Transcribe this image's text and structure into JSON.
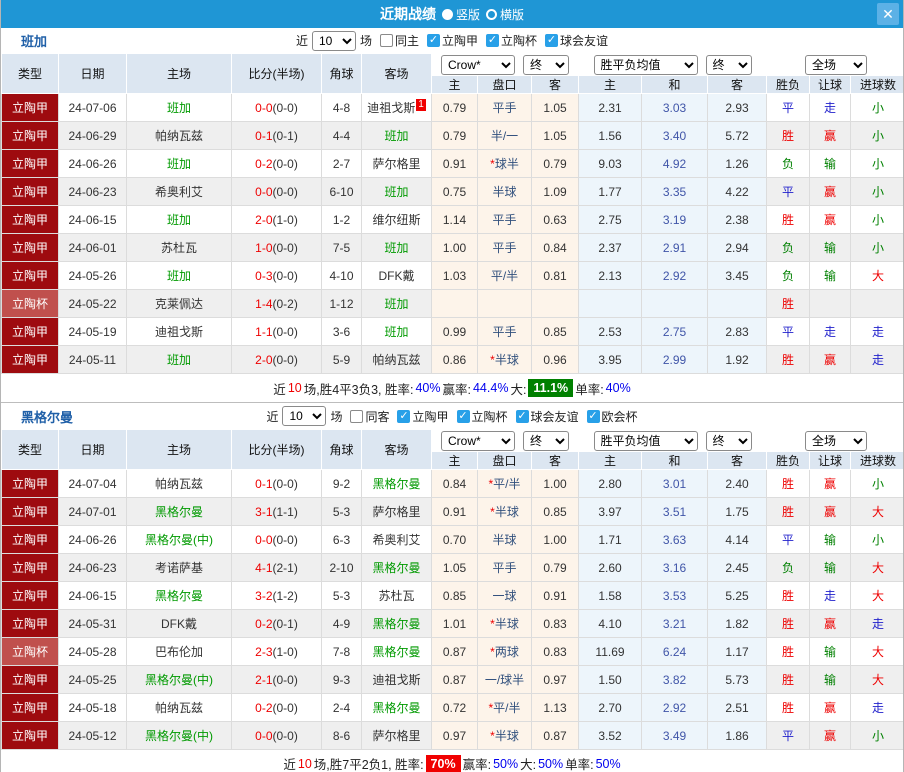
{
  "title_bar": {
    "title": "近期战绩",
    "layout_options": [
      {
        "label": "竖版",
        "selected": true
      },
      {
        "label": "横版",
        "selected": false
      }
    ],
    "close_icon": "✕"
  },
  "table_header": {
    "cols": [
      "类型",
      "日期",
      "主场",
      "比分(半场)",
      "角球",
      "客场"
    ],
    "sub_cols": [
      "主",
      "盘口",
      "客",
      "主",
      "和",
      "客",
      "胜负",
      "让球",
      "进球数"
    ],
    "selects": {
      "bookmaker": "Crow*",
      "final1": "终",
      "avg": "胜平负均值",
      "final2": "终",
      "scope": "全场"
    }
  },
  "result_colors": {
    "胜": "#ee0000",
    "赢": "#ee0000",
    "大": "#ee0000",
    "平": "#2222cc",
    "走": "#2222cc",
    "负": "#008000",
    "输": "#008000",
    "小": "#008000"
  },
  "colors": {
    "title_bar": "#1f96d5",
    "league_cell": "#9e0b0f",
    "cup_cell": "#c0504d",
    "handicap_bg": "#fdf4ea",
    "odds_bg": "#edf5fb",
    "header_bg": "#dce6f1"
  },
  "sections": [
    {
      "team": "班加",
      "filter": {
        "prefix": "近",
        "count": "10",
        "suffix": "场",
        "checkboxes": [
          {
            "label": "同主",
            "checked": false
          },
          {
            "label": "立陶甲",
            "checked": true
          },
          {
            "label": "立陶杯",
            "checked": true
          },
          {
            "label": "球会友谊",
            "checked": true
          }
        ]
      },
      "rows": [
        {
          "league": "立陶甲",
          "cup": false,
          "date": "24-07-06",
          "home": "班加",
          "home_active": true,
          "score": "0-0",
          "half": "(0-0)",
          "corners": "4-8",
          "away": "迪祖戈斯",
          "away_active": false,
          "away_badge": "1",
          "ah": [
            "0.79",
            "平手",
            "1.05"
          ],
          "odds": [
            "2.31",
            "3.03",
            "2.93"
          ],
          "results": [
            "平",
            "走",
            "小"
          ]
        },
        {
          "league": "立陶甲",
          "cup": false,
          "date": "24-06-29",
          "home": "帕纳瓦兹",
          "home_active": false,
          "score": "0-1",
          "half": "(0-1)",
          "corners": "4-4",
          "away": "班加",
          "away_active": true,
          "away_badge": "",
          "ah": [
            "0.79",
            "半/一",
            "1.05"
          ],
          "odds": [
            "1.56",
            "3.40",
            "5.72"
          ],
          "results": [
            "胜",
            "赢",
            "小"
          ]
        },
        {
          "league": "立陶甲",
          "cup": false,
          "date": "24-06-26",
          "home": "班加",
          "home_active": true,
          "score": "0-2",
          "half": "(0-0)",
          "corners": "2-7",
          "away": "萨尔格里",
          "away_active": false,
          "away_badge": "",
          "ah": [
            "0.91",
            "*球半",
            "0.79"
          ],
          "odds": [
            "9.03",
            "4.92",
            "1.26"
          ],
          "results": [
            "负",
            "输",
            "小"
          ]
        },
        {
          "league": "立陶甲",
          "cup": false,
          "date": "24-06-23",
          "home": "希奥利艾",
          "home_active": false,
          "score": "0-0",
          "half": "(0-0)",
          "corners": "6-10",
          "away": "班加",
          "away_active": true,
          "away_badge": "",
          "ah": [
            "0.75",
            "半球",
            "1.09"
          ],
          "odds": [
            "1.77",
            "3.35",
            "4.22"
          ],
          "results": [
            "平",
            "赢",
            "小"
          ]
        },
        {
          "league": "立陶甲",
          "cup": false,
          "date": "24-06-15",
          "home": "班加",
          "home_active": true,
          "score": "2-0",
          "half": "(1-0)",
          "corners": "1-2",
          "away": "维尔纽斯",
          "away_active": false,
          "away_badge": "",
          "ah": [
            "1.14",
            "平手",
            "0.63"
          ],
          "odds": [
            "2.75",
            "3.19",
            "2.38"
          ],
          "results": [
            "胜",
            "赢",
            "小"
          ]
        },
        {
          "league": "立陶甲",
          "cup": false,
          "date": "24-06-01",
          "home": "苏杜瓦",
          "home_active": false,
          "score": "1-0",
          "half": "(0-0)",
          "corners": "7-5",
          "away": "班加",
          "away_active": true,
          "away_badge": "",
          "ah": [
            "1.00",
            "平手",
            "0.84"
          ],
          "odds": [
            "2.37",
            "2.91",
            "2.94"
          ],
          "results": [
            "负",
            "输",
            "小"
          ]
        },
        {
          "league": "立陶甲",
          "cup": false,
          "date": "24-05-26",
          "home": "班加",
          "home_active": true,
          "score": "0-3",
          "half": "(0-0)",
          "corners": "4-10",
          "away": "DFK戴",
          "away_active": false,
          "away_badge": "",
          "ah": [
            "1.03",
            "平/半",
            "0.81"
          ],
          "odds": [
            "2.13",
            "2.92",
            "3.45"
          ],
          "results": [
            "负",
            "输",
            "大"
          ]
        },
        {
          "league": "立陶杯",
          "cup": true,
          "date": "24-05-22",
          "home": "克莱佩达",
          "home_active": false,
          "score": "1-4",
          "half": "(0-2)",
          "corners": "1-12",
          "away": "班加",
          "away_active": true,
          "away_badge": "",
          "ah": [
            "",
            "",
            ""
          ],
          "odds": [
            "",
            "",
            ""
          ],
          "results": [
            "胜",
            "",
            ""
          ]
        },
        {
          "league": "立陶甲",
          "cup": false,
          "date": "24-05-19",
          "home": "迪祖戈斯",
          "home_active": false,
          "score": "1-1",
          "half": "(0-0)",
          "corners": "3-6",
          "away": "班加",
          "away_active": true,
          "away_badge": "",
          "ah": [
            "0.99",
            "平手",
            "0.85"
          ],
          "odds": [
            "2.53",
            "2.75",
            "2.83"
          ],
          "results": [
            "平",
            "走",
            "走"
          ]
        },
        {
          "league": "立陶甲",
          "cup": false,
          "date": "24-05-11",
          "home": "班加",
          "home_active": true,
          "score": "2-0",
          "half": "(0-0)",
          "corners": "5-9",
          "away": "帕纳瓦兹",
          "away_active": false,
          "away_badge": "",
          "ah": [
            "0.86",
            "*半球",
            "0.96"
          ],
          "odds": [
            "3.95",
            "2.99",
            "1.92"
          ],
          "results": [
            "胜",
            "赢",
            "走"
          ]
        }
      ],
      "summary": [
        {
          "text": "近",
          "style": "plain"
        },
        {
          "text": "10",
          "style": "red"
        },
        {
          "text": "场,胜4平3负3, 胜率:",
          "style": "plain"
        },
        {
          "text": "40%",
          "style": "blue"
        },
        {
          "text": " 赢率:",
          "style": "plain"
        },
        {
          "text": "44.4%",
          "style": "blue"
        },
        {
          "text": " 大:",
          "style": "plain"
        },
        {
          "text": "11.1%",
          "style": "green-badge"
        },
        {
          "text": " 单率:",
          "style": "plain"
        },
        {
          "text": "40%",
          "style": "blue"
        }
      ]
    },
    {
      "team": "黑格尔曼",
      "filter": {
        "prefix": "近",
        "count": "10",
        "suffix": "场",
        "checkboxes": [
          {
            "label": "同客",
            "checked": false
          },
          {
            "label": "立陶甲",
            "checked": true
          },
          {
            "label": "立陶杯",
            "checked": true
          },
          {
            "label": "球会友谊",
            "checked": true
          },
          {
            "label": "欧会杯",
            "checked": true
          }
        ]
      },
      "rows": [
        {
          "league": "立陶甲",
          "cup": false,
          "date": "24-07-04",
          "home": "帕纳瓦兹",
          "home_active": false,
          "score": "0-1",
          "half": "(0-0)",
          "corners": "9-2",
          "away": "黑格尔曼",
          "away_active": true,
          "away_badge": "",
          "ah": [
            "0.84",
            "*平/半",
            "1.00"
          ],
          "odds": [
            "2.80",
            "3.01",
            "2.40"
          ],
          "results": [
            "胜",
            "赢",
            "小"
          ]
        },
        {
          "league": "立陶甲",
          "cup": false,
          "date": "24-07-01",
          "home": "黑格尔曼",
          "home_active": true,
          "score": "3-1",
          "half": "(1-1)",
          "corners": "5-3",
          "away": "萨尔格里",
          "away_active": false,
          "away_badge": "",
          "ah": [
            "0.91",
            "*半球",
            "0.85"
          ],
          "odds": [
            "3.97",
            "3.51",
            "1.75"
          ],
          "results": [
            "胜",
            "赢",
            "大"
          ]
        },
        {
          "league": "立陶甲",
          "cup": false,
          "date": "24-06-26",
          "home": "黑格尔曼(中)",
          "home_active": true,
          "score": "0-0",
          "half": "(0-0)",
          "corners": "6-3",
          "away": "希奥利艾",
          "away_active": false,
          "away_badge": "",
          "ah": [
            "0.70",
            "半球",
            "1.00"
          ],
          "odds": [
            "1.71",
            "3.63",
            "4.14"
          ],
          "results": [
            "平",
            "输",
            "小"
          ]
        },
        {
          "league": "立陶甲",
          "cup": false,
          "date": "24-06-23",
          "home": "考诺萨基",
          "home_active": false,
          "score": "4-1",
          "half": "(2-1)",
          "corners": "2-10",
          "away": "黑格尔曼",
          "away_active": true,
          "away_badge": "",
          "ah": [
            "1.05",
            "平手",
            "0.79"
          ],
          "odds": [
            "2.60",
            "3.16",
            "2.45"
          ],
          "results": [
            "负",
            "输",
            "大"
          ]
        },
        {
          "league": "立陶甲",
          "cup": false,
          "date": "24-06-15",
          "home": "黑格尔曼",
          "home_active": true,
          "score": "3-2",
          "half": "(1-2)",
          "corners": "5-3",
          "away": "苏杜瓦",
          "away_active": false,
          "away_badge": "",
          "ah": [
            "0.85",
            "一球",
            "0.91"
          ],
          "odds": [
            "1.58",
            "3.53",
            "5.25"
          ],
          "results": [
            "胜",
            "走",
            "大"
          ]
        },
        {
          "league": "立陶甲",
          "cup": false,
          "date": "24-05-31",
          "home": "DFK戴",
          "home_active": false,
          "score": "0-2",
          "half": "(0-1)",
          "corners": "4-9",
          "away": "黑格尔曼",
          "away_active": true,
          "away_badge": "",
          "ah": [
            "1.01",
            "*半球",
            "0.83"
          ],
          "odds": [
            "4.10",
            "3.21",
            "1.82"
          ],
          "results": [
            "胜",
            "赢",
            "走"
          ]
        },
        {
          "league": "立陶杯",
          "cup": true,
          "date": "24-05-28",
          "home": "巴布伦加",
          "home_active": false,
          "score": "2-3",
          "half": "(1-0)",
          "corners": "7-8",
          "away": "黑格尔曼",
          "away_active": true,
          "away_badge": "",
          "ah": [
            "0.87",
            "*两球",
            "0.83"
          ],
          "odds": [
            "11.69",
            "6.24",
            "1.17"
          ],
          "results": [
            "胜",
            "输",
            "大"
          ]
        },
        {
          "league": "立陶甲",
          "cup": false,
          "date": "24-05-25",
          "home": "黑格尔曼(中)",
          "home_active": true,
          "score": "2-1",
          "half": "(0-0)",
          "corners": "9-3",
          "away": "迪祖戈斯",
          "away_active": false,
          "away_badge": "",
          "ah": [
            "0.87",
            "一/球半",
            "0.97"
          ],
          "odds": [
            "1.50",
            "3.82",
            "5.73"
          ],
          "results": [
            "胜",
            "输",
            "大"
          ]
        },
        {
          "league": "立陶甲",
          "cup": false,
          "date": "24-05-18",
          "home": "帕纳瓦兹",
          "home_active": false,
          "score": "0-2",
          "half": "(0-0)",
          "corners": "2-4",
          "away": "黑格尔曼",
          "away_active": true,
          "away_badge": "",
          "ah": [
            "0.72",
            "*平/半",
            "1.13"
          ],
          "odds": [
            "2.70",
            "2.92",
            "2.51"
          ],
          "results": [
            "胜",
            "赢",
            "走"
          ]
        },
        {
          "league": "立陶甲",
          "cup": false,
          "date": "24-05-12",
          "home": "黑格尔曼(中)",
          "home_active": true,
          "score": "0-0",
          "half": "(0-0)",
          "corners": "8-6",
          "away": "萨尔格里",
          "away_active": false,
          "away_badge": "",
          "ah": [
            "0.97",
            "*半球",
            "0.87"
          ],
          "odds": [
            "3.52",
            "3.49",
            "1.86"
          ],
          "results": [
            "平",
            "赢",
            "小"
          ]
        }
      ],
      "summary": [
        {
          "text": "近",
          "style": "plain"
        },
        {
          "text": "10",
          "style": "red"
        },
        {
          "text": "场,胜7平2负1, 胜率:",
          "style": "plain"
        },
        {
          "text": "70%",
          "style": "red-badge"
        },
        {
          "text": " 赢率:",
          "style": "plain"
        },
        {
          "text": "50%",
          "style": "blue"
        },
        {
          "text": " 大:",
          "style": "plain"
        },
        {
          "text": "50%",
          "style": "blue"
        },
        {
          "text": " 单率:",
          "style": "plain"
        },
        {
          "text": "50%",
          "style": "blue"
        }
      ]
    }
  ]
}
